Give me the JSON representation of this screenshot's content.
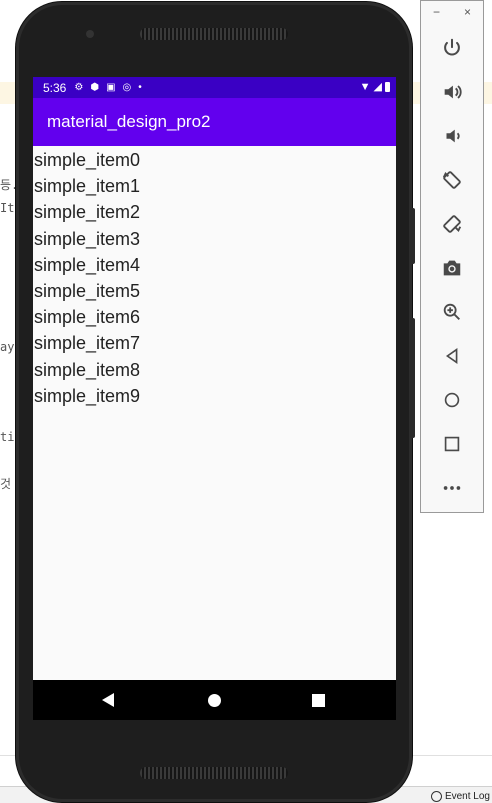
{
  "ide": {
    "fragments": [
      "등.",
      "It",
      "ay",
      "ti",
      "것"
    ],
    "event_log_label": "Event Log"
  },
  "emulator": {
    "status_bar": {
      "time": "5:36"
    },
    "app_bar": {
      "title": "material_design_pro2"
    },
    "list_items": [
      "simple_item0",
      "simple_item1",
      "simple_item2",
      "simple_item3",
      "simple_item4",
      "simple_item5",
      "simple_item6",
      "simple_item7",
      "simple_item8",
      "simple_item9"
    ],
    "colors": {
      "status_bar": "#3a00c4",
      "app_bar": "#6200ee",
      "screen": "#fafafa",
      "phone_body": "#1e1e1e"
    }
  },
  "toolbar": {
    "minimize_label": "−",
    "close_label": "×",
    "buttons": [
      "power-icon",
      "volume-up-icon",
      "volume-down-icon",
      "rotate-left-icon",
      "rotate-right-icon",
      "camera-icon",
      "zoom-icon",
      "back-icon",
      "home-icon",
      "overview-icon",
      "more-icon"
    ]
  }
}
